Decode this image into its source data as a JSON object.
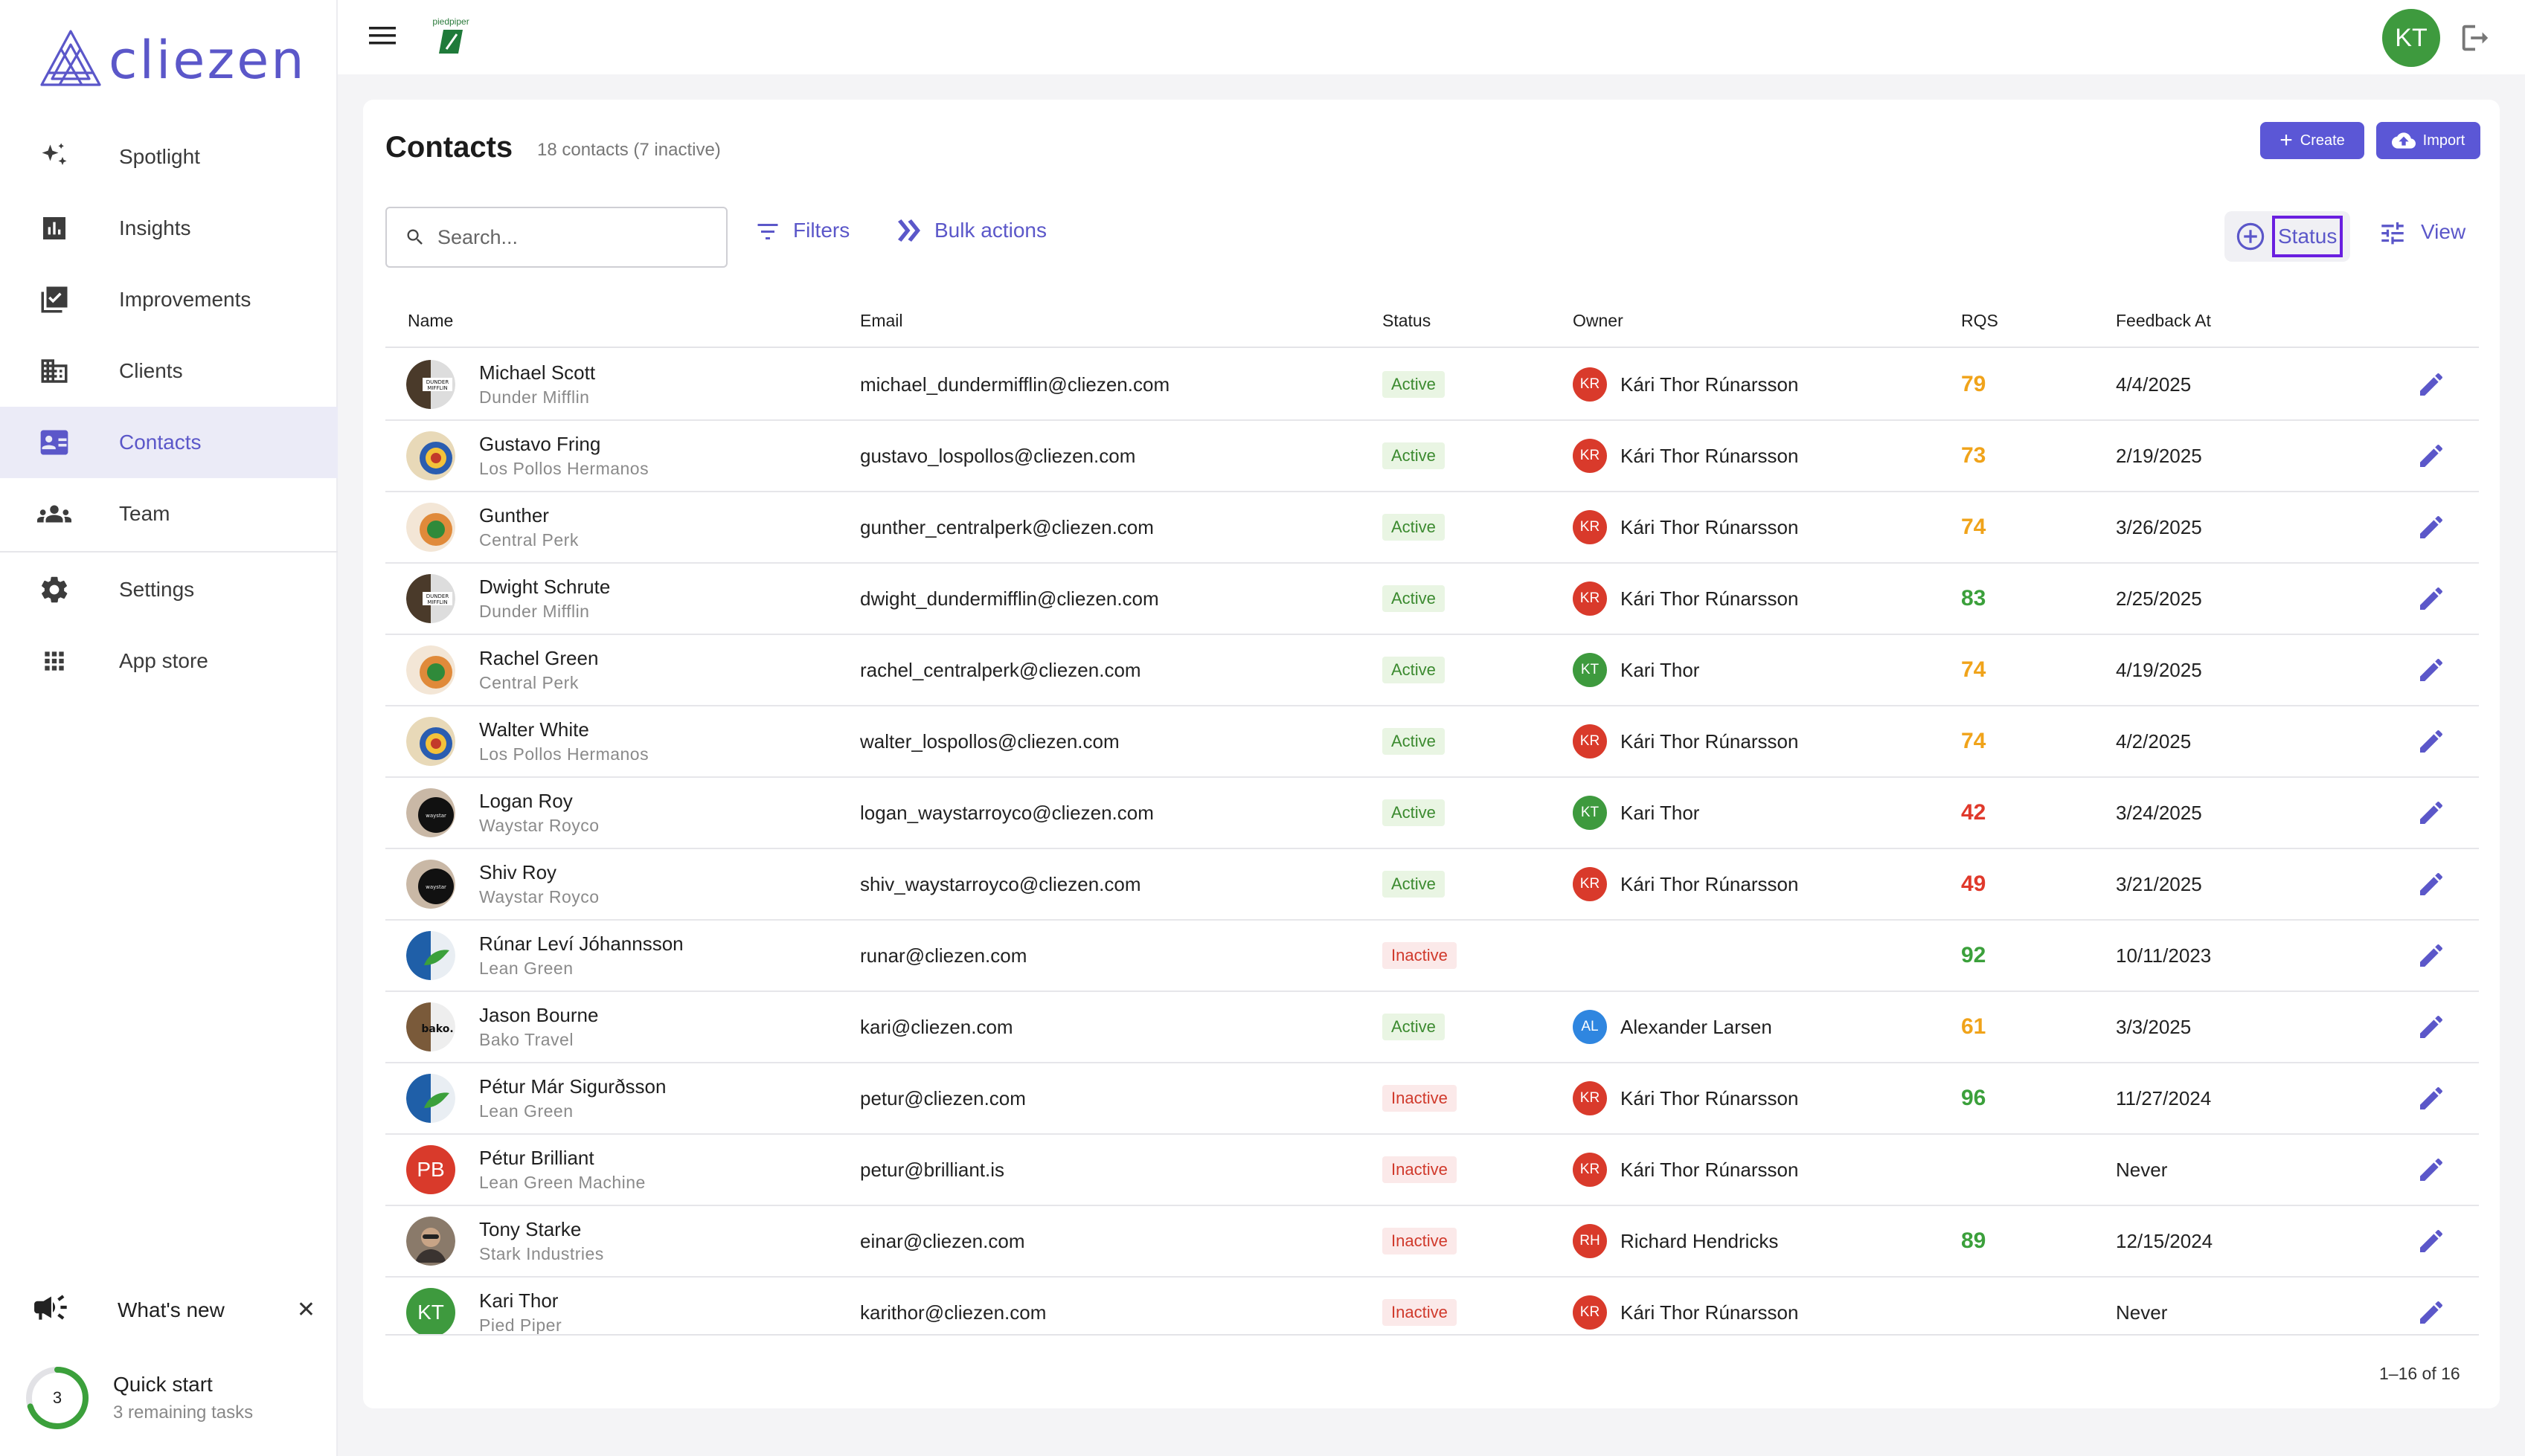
{
  "brand": {
    "name": "cliezen"
  },
  "nav": {
    "items": [
      {
        "label": "Spotlight",
        "icon": "sparkle-icon"
      },
      {
        "label": "Insights",
        "icon": "chart-icon"
      },
      {
        "label": "Improvements",
        "icon": "checklist-icon"
      },
      {
        "label": "Clients",
        "icon": "building-icon"
      },
      {
        "label": "Contacts",
        "icon": "contact-card-icon",
        "active": true
      },
      {
        "label": "Team",
        "icon": "group-icon"
      },
      {
        "label": "Settings",
        "icon": "gear-icon"
      },
      {
        "label": "App store",
        "icon": "grid-icon"
      }
    ],
    "whats_new": "What's new",
    "quick_start": {
      "title": "Quick start",
      "subtitle": "3 remaining tasks",
      "count": "3",
      "progress": 0.7
    }
  },
  "header": {
    "org_logo_label": "piedpiper",
    "user_initials": "KT"
  },
  "page": {
    "title": "Contacts",
    "subtitle": "18 contacts (7 inactive)",
    "create_label": "Create",
    "import_label": "Import",
    "search_placeholder": "Search...",
    "filters_label": "Filters",
    "bulk_label": "Bulk actions",
    "status_label": "Status",
    "view_label": "View",
    "pagination": "1–16 of 16"
  },
  "table": {
    "columns": {
      "name": "Name",
      "email": "Email",
      "status": "Status",
      "owner": "Owner",
      "rqs": "RQS",
      "feedback": "Feedback At"
    },
    "rows": [
      {
        "name": "Michael Scott",
        "company": "Dunder Mifflin",
        "email": "michael_dundermifflin@cliezen.com",
        "status": "Active",
        "owner": "Kári Thor Rúnarsson",
        "owner_initials": "KR",
        "owner_color": "#d93a2b",
        "rqs": "79",
        "rqs_color": "#f0a31a",
        "feedback": "4/4/2025",
        "avatar": "dunder"
      },
      {
        "name": "Gustavo Fring",
        "company": "Los Pollos Hermanos",
        "email": "gustavo_lospollos@cliezen.com",
        "status": "Active",
        "owner": "Kári Thor Rúnarsson",
        "owner_initials": "KR",
        "owner_color": "#d93a2b",
        "rqs": "73",
        "rqs_color": "#f0a31a",
        "feedback": "2/19/2025",
        "avatar": "pollos"
      },
      {
        "name": "Gunther",
        "company": "Central Perk",
        "email": "gunther_centralperk@cliezen.com",
        "status": "Active",
        "owner": "Kári Thor Rúnarsson",
        "owner_initials": "KR",
        "owner_color": "#d93a2b",
        "rqs": "74",
        "rqs_color": "#f0a31a",
        "feedback": "3/26/2025",
        "avatar": "perk"
      },
      {
        "name": "Dwight Schrute",
        "company": "Dunder Mifflin",
        "email": "dwight_dundermifflin@cliezen.com",
        "status": "Active",
        "owner": "Kári Thor Rúnarsson",
        "owner_initials": "KR",
        "owner_color": "#d93a2b",
        "rqs": "83",
        "rqs_color": "#3ba03b",
        "feedback": "2/25/2025",
        "avatar": "dunder"
      },
      {
        "name": "Rachel Green",
        "company": "Central Perk",
        "email": "rachel_centralperk@cliezen.com",
        "status": "Active",
        "owner": "Kari Thor",
        "owner_initials": "KT",
        "owner_color": "#3e9a3e",
        "rqs": "74",
        "rqs_color": "#f0a31a",
        "feedback": "4/19/2025",
        "avatar": "perk"
      },
      {
        "name": "Walter White",
        "company": "Los Pollos Hermanos",
        "email": "walter_lospollos@cliezen.com",
        "status": "Active",
        "owner": "Kári Thor Rúnarsson",
        "owner_initials": "KR",
        "owner_color": "#d93a2b",
        "rqs": "74",
        "rqs_color": "#f0a31a",
        "feedback": "4/2/2025",
        "avatar": "pollos"
      },
      {
        "name": "Logan Roy",
        "company": "Waystar Royco",
        "email": "logan_waystarroyco@cliezen.com",
        "status": "Active",
        "owner": "Kari Thor",
        "owner_initials": "KT",
        "owner_color": "#3e9a3e",
        "rqs": "42",
        "rqs_color": "#e0392b",
        "feedback": "3/24/2025",
        "avatar": "waystar"
      },
      {
        "name": "Shiv Roy",
        "company": "Waystar Royco",
        "email": "shiv_waystarroyco@cliezen.com",
        "status": "Active",
        "owner": "Kári Thor Rúnarsson",
        "owner_initials": "KR",
        "owner_color": "#d93a2b",
        "rqs": "49",
        "rqs_color": "#e0392b",
        "feedback": "3/21/2025",
        "avatar": "waystar"
      },
      {
        "name": "Rúnar Leví Jóhannsson",
        "company": "Lean Green",
        "email": "runar@cliezen.com",
        "status": "Inactive",
        "owner": "",
        "owner_initials": "",
        "owner_color": "",
        "rqs": "92",
        "rqs_color": "#3ba03b",
        "feedback": "10/11/2023",
        "avatar": "leangreen"
      },
      {
        "name": "Jason Bourne",
        "company": "Bako Travel",
        "email": "kari@cliezen.com",
        "status": "Active",
        "owner": "Alexander Larsen",
        "owner_initials": "AL",
        "owner_color": "#2f86e0",
        "rqs": "61",
        "rqs_color": "#f0a31a",
        "feedback": "3/3/2025",
        "avatar": "bako"
      },
      {
        "name": "Pétur Már Sigurðsson",
        "company": "Lean Green",
        "email": "petur@cliezen.com",
        "status": "Inactive",
        "owner": "Kári Thor Rúnarsson",
        "owner_initials": "KR",
        "owner_color": "#d93a2b",
        "rqs": "96",
        "rqs_color": "#3ba03b",
        "feedback": "11/27/2024",
        "avatar": "leangreen"
      },
      {
        "name": "Pétur Brilliant",
        "company": "Lean Green Machine",
        "email": "petur@brilliant.is",
        "status": "Inactive",
        "owner": "Kári Thor Rúnarsson",
        "owner_initials": "KR",
        "owner_color": "#d93a2b",
        "rqs": "",
        "rqs_color": "#3ba03b",
        "feedback": "Never",
        "avatar": "initials",
        "avatar_initials": "PB",
        "avatar_color": "#d93a2b"
      },
      {
        "name": "Tony Starke",
        "company": "Stark Industries",
        "email": "einar@cliezen.com",
        "status": "Inactive",
        "owner": "Richard Hendricks",
        "owner_initials": "RH",
        "owner_color": "#d93a2b",
        "rqs": "89",
        "rqs_color": "#3ba03b",
        "feedback": "12/15/2024",
        "avatar": "photo"
      },
      {
        "name": "Kari Thor",
        "company": "Pied Piper",
        "email": "karithor@cliezen.com",
        "status": "Inactive",
        "owner": "Kári Thor Rúnarsson",
        "owner_initials": "KR",
        "owner_color": "#d93a2b",
        "rqs": "",
        "rqs_color": "#3ba03b",
        "feedback": "Never",
        "avatar": "initials",
        "avatar_initials": "KT",
        "avatar_color": "#3e9a3e"
      }
    ]
  }
}
